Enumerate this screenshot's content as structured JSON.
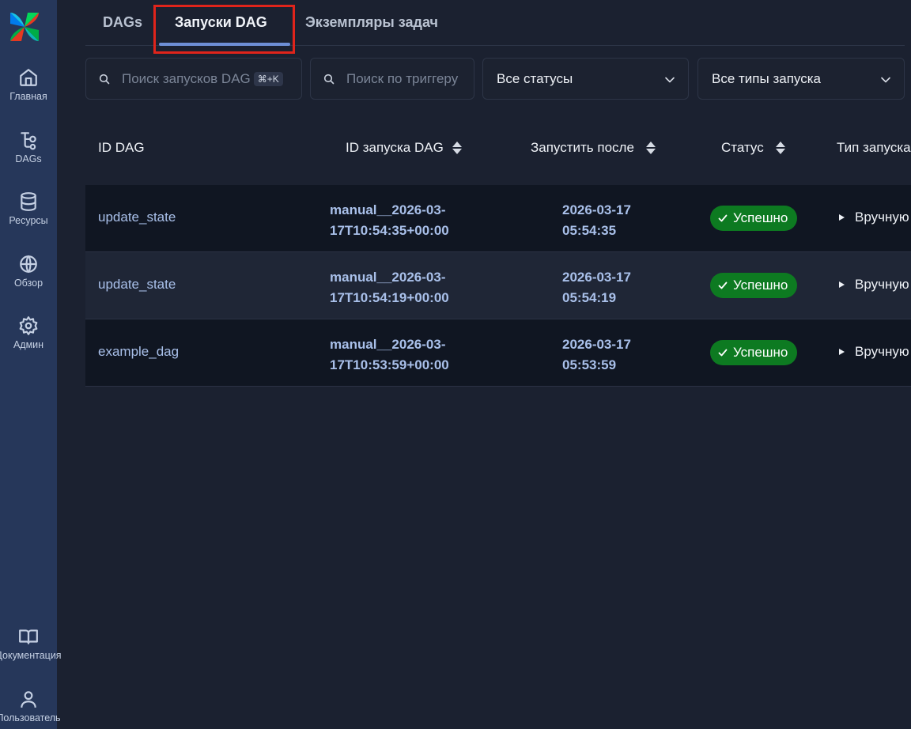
{
  "sidebar": {
    "items": [
      {
        "label": "Главная",
        "icon": "home-icon"
      },
      {
        "label": "DAGs",
        "icon": "dags-icon"
      },
      {
        "label": "Ресурсы",
        "icon": "database-icon"
      },
      {
        "label": "Обзор",
        "icon": "globe-icon"
      },
      {
        "label": "Админ",
        "icon": "gear-icon"
      }
    ],
    "bottom_items": [
      {
        "label": "Документация",
        "icon": "book-icon"
      },
      {
        "label": "Пользователь",
        "icon": "user-icon"
      }
    ]
  },
  "tabs": [
    {
      "label": "DAGs"
    },
    {
      "label": "Запуски DAG"
    },
    {
      "label": "Экземпляры задач"
    }
  ],
  "filters": {
    "search_runs_placeholder": "Поиск запусков DAG",
    "search_shortcut": "⌘+K",
    "search_trigger_placeholder": "Поиск по триггеру",
    "status_value": "Все статусы",
    "run_type_value": "Все типы запуска"
  },
  "table": {
    "headers": [
      "ID DAG",
      "ID запуска DAG",
      "Запустить после",
      "Статус",
      "Тип запуска"
    ],
    "rows": [
      {
        "dag_id": "update_state",
        "run_id_1": "manual__2026-03-",
        "run_id_2": "17T10:54:35+00:00",
        "run_after_1": "2026-03-17",
        "run_after_2": "05:54:35",
        "status": "Успешно",
        "run_type": "Вручную"
      },
      {
        "dag_id": "update_state",
        "run_id_1": "manual__2026-03-",
        "run_id_2": "17T10:54:19+00:00",
        "run_after_1": "2026-03-17",
        "run_after_2": "05:54:19",
        "status": "Успешно",
        "run_type": "Вручную"
      },
      {
        "dag_id": "example_dag",
        "run_id_1": "manual__2026-03-",
        "run_id_2": "17T10:53:59+00:00",
        "run_after_1": "2026-03-17",
        "run_after_2": "05:53:59",
        "status": "Успешно",
        "run_type": "Вручную"
      }
    ]
  },
  "colors": {
    "sidebar_bg": "#26375a",
    "page_bg": "#1b2130",
    "success": "#0d7a21",
    "link": "#a9c0ea",
    "active_tab_underline": "#6e8fd6",
    "highlight_box": "#e0241b"
  }
}
